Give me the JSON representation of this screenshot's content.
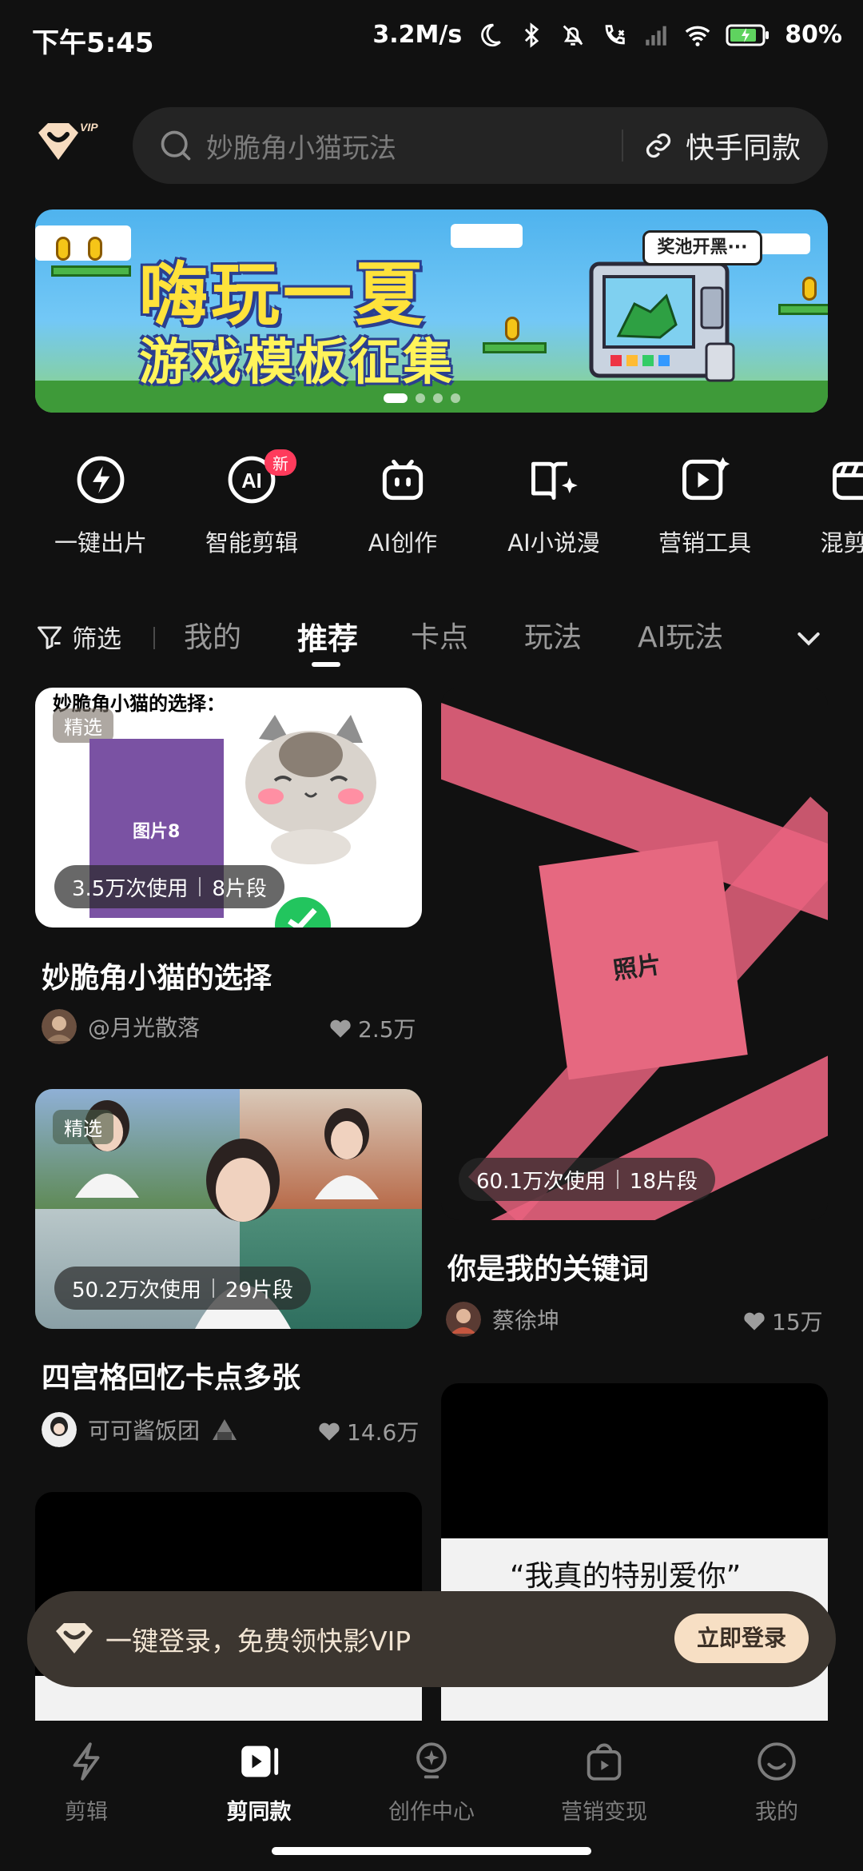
{
  "status_bar": {
    "time": "下午5:45",
    "net_speed": "3.2M/s",
    "battery": "80%"
  },
  "header": {
    "vip_logo_label": "VIP",
    "search_placeholder": "妙脆角小猫玩法",
    "link_button_label": "快手同款"
  },
  "banner": {
    "title_line1": "嗨玩一夏",
    "title_line2": "游戏模板征集",
    "bubble_text": "奖池开黑···"
  },
  "tools": [
    {
      "label": "一键出片",
      "icon": "lightning-icon"
    },
    {
      "label": "智能剪辑",
      "icon": "ai-circle-icon",
      "badge": "新"
    },
    {
      "label": "AI创作",
      "icon": "robot-icon"
    },
    {
      "label": "AI小说漫",
      "icon": "book-sparkle-icon"
    },
    {
      "label": "营销工具",
      "icon": "play-sparkle-icon"
    },
    {
      "label": "混剪视",
      "icon": "clapper-icon"
    }
  ],
  "categories": {
    "filter_label": "筛选",
    "tabs": [
      "我的",
      "推荐",
      "卡点",
      "玩法",
      "AI玩法"
    ],
    "active": "推荐"
  },
  "cards": [
    {
      "overlay_title": "妙脆角小猫的选择：",
      "tag": "精选",
      "placeholder_label": "图片8",
      "usage": "3.5万次使用",
      "segments": "8片段",
      "title": "妙脆角小猫的选择",
      "author": "@月光散落",
      "likes": "2.5万"
    },
    {
      "photo_label": "照片",
      "usage": "60.1万次使用",
      "segments": "18片段",
      "title": "你是我的关键词",
      "author": "蔡徐坤",
      "likes": "15万"
    },
    {
      "tag": "精选",
      "usage": "50.2万次使用",
      "segments": "29片段",
      "title": "四宫格回忆卡点多张",
      "author": "可可酱饭团",
      "likes": "14.6万"
    },
    {
      "quote": "“我真的特别爱你”"
    }
  ],
  "toast": {
    "text": "一键登录，免费领快影VIP",
    "button": "立即登录"
  },
  "bottom_nav": [
    {
      "label": "剪辑",
      "icon": "lightning-icon"
    },
    {
      "label": "剪同款",
      "icon": "play-square-icon",
      "active": true
    },
    {
      "label": "创作中心",
      "icon": "bulb-icon"
    },
    {
      "label": "营销变现",
      "icon": "bag-icon"
    },
    {
      "label": "我的",
      "icon": "smile-icon"
    }
  ],
  "colors": {
    "background": "#111111",
    "accent_pink": "#e8637e",
    "toast_bg": "#3c3630",
    "toast_button": "#f7dfc4"
  }
}
